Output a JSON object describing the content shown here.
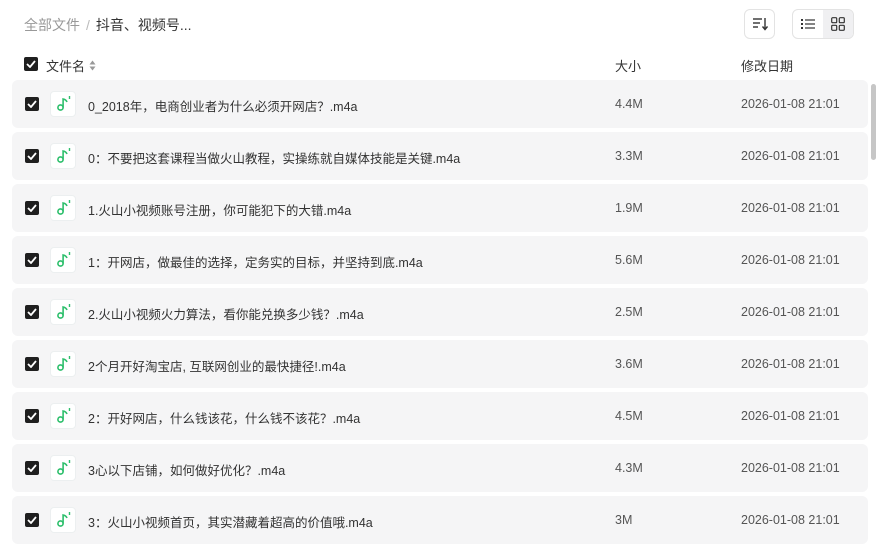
{
  "breadcrumb": {
    "root": "全部文件",
    "separator": "/",
    "current": "抖音、视频号..."
  },
  "toolbar": {
    "sort_icon": "sort-icon",
    "list_view_icon": "list-view-icon",
    "grid_view_icon": "grid-view-icon",
    "active_view": "list"
  },
  "table": {
    "columns": {
      "name": "文件名",
      "size": "大小",
      "modified": "修改日期"
    },
    "rows": [
      {
        "name": "0_2018年，电商创业者为什么必须开网店？.m4a",
        "size": "4.4M",
        "modified": "2026-01-08 21:01",
        "checked": true
      },
      {
        "name": "0：不要把这套课程当做火山教程，实操练就自媒体技能是关键.m4a",
        "size": "3.3M",
        "modified": "2026-01-08 21:01",
        "checked": true
      },
      {
        "name": "1.火山小视频账号注册，你可能犯下的大错.m4a",
        "size": "1.9M",
        "modified": "2026-01-08 21:01",
        "checked": true
      },
      {
        "name": "1：开网店，做最佳的选择，定务实的目标，并坚持到底.m4a",
        "size": "5.6M",
        "modified": "2026-01-08 21:01",
        "checked": true
      },
      {
        "name": "2.火山小视频火力算法，看你能兑换多少钱？.m4a",
        "size": "2.5M",
        "modified": "2026-01-08 21:01",
        "checked": true
      },
      {
        "name": "2个月开好淘宝店, 互联网创业的最快捷径!.m4a",
        "size": "3.6M",
        "modified": "2026-01-08 21:01",
        "checked": true
      },
      {
        "name": "2：开好网店，什么钱该花，什么钱不该花？.m4a",
        "size": "4.5M",
        "modified": "2026-01-08 21:01",
        "checked": true
      },
      {
        "name": "3心以下店铺，如何做好优化？.m4a",
        "size": "4.3M",
        "modified": "2026-01-08 21:01",
        "checked": true
      },
      {
        "name": "3：火山小视频首页，其实潜藏着超高的价值哦.m4a",
        "size": "3M",
        "modified": "2026-01-08 21:01",
        "checked": true
      }
    ]
  },
  "colors": {
    "row_bg": "#f5f5f6",
    "checkbox": "#1f1f1f",
    "audio_icon": "#2dbf6c"
  },
  "icons": {
    "file": "audio-file-icon",
    "check": "check-icon",
    "sort_caret": "sort-caret-icon"
  }
}
